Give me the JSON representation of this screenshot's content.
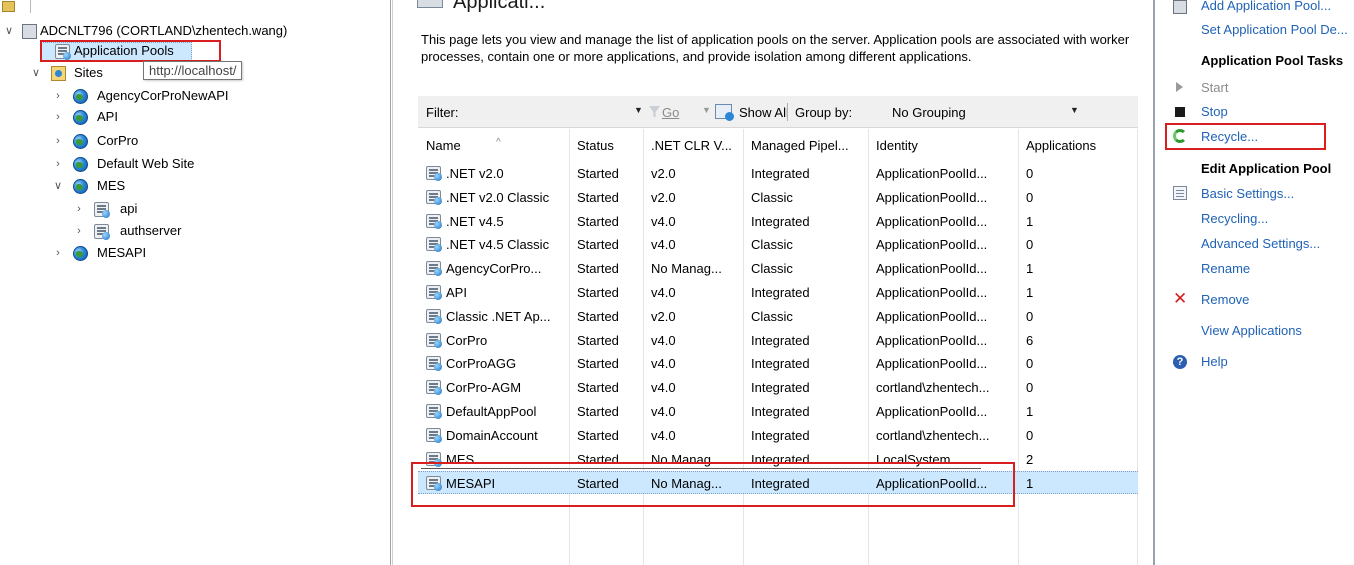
{
  "tree": {
    "server": "ADCNLT796 (CORTLAND\\zhentech.wang)",
    "application_pools": "Application Pools",
    "sites": "Sites",
    "tooltip": "http://localhost/",
    "site_items": [
      "AgencyCorProNewAPI",
      "API",
      "CorPro",
      "Default Web Site",
      "MES",
      "MESAPI"
    ],
    "mes_children": [
      "api",
      "authserver"
    ]
  },
  "main": {
    "title": "Applicati...",
    "description": "This page lets you view and manage the list of application pools on the server. Application pools are associated with worker processes, contain one or more applications, and provide isolation among different applications.",
    "filter_label": "Filter:",
    "filter_value": "",
    "go_label": "Go",
    "show_all_label": "Show All",
    "group_by_label": "Group by:",
    "group_by_value": "No Grouping",
    "columns": [
      "Name",
      "Status",
      ".NET CLR V...",
      "Managed Pipel...",
      "Identity",
      "Applications"
    ],
    "rows": [
      {
        "name": ".NET v2.0",
        "status": "Started",
        "clr": "v2.0",
        "pipeline": "Integrated",
        "identity": "ApplicationPoolId...",
        "apps": "0"
      },
      {
        "name": ".NET v2.0 Classic",
        "status": "Started",
        "clr": "v2.0",
        "pipeline": "Classic",
        "identity": "ApplicationPoolId...",
        "apps": "0"
      },
      {
        "name": ".NET v4.5",
        "status": "Started",
        "clr": "v4.0",
        "pipeline": "Integrated",
        "identity": "ApplicationPoolId...",
        "apps": "1"
      },
      {
        "name": ".NET v4.5 Classic",
        "status": "Started",
        "clr": "v4.0",
        "pipeline": "Classic",
        "identity": "ApplicationPoolId...",
        "apps": "0"
      },
      {
        "name": "AgencyCorPro...",
        "status": "Started",
        "clr": "No Manag...",
        "pipeline": "Classic",
        "identity": "ApplicationPoolId...",
        "apps": "1"
      },
      {
        "name": "API",
        "status": "Started",
        "clr": "v4.0",
        "pipeline": "Integrated",
        "identity": "ApplicationPoolId...",
        "apps": "1"
      },
      {
        "name": "Classic .NET Ap...",
        "status": "Started",
        "clr": "v2.0",
        "pipeline": "Classic",
        "identity": "ApplicationPoolId...",
        "apps": "0"
      },
      {
        "name": "CorPro",
        "status": "Started",
        "clr": "v4.0",
        "pipeline": "Integrated",
        "identity": "ApplicationPoolId...",
        "apps": "6"
      },
      {
        "name": "CorProAGG",
        "status": "Started",
        "clr": "v4.0",
        "pipeline": "Integrated",
        "identity": "ApplicationPoolId...",
        "apps": "0"
      },
      {
        "name": "CorPro-AGM",
        "status": "Started",
        "clr": "v4.0",
        "pipeline": "Integrated",
        "identity": "cortland\\zhentech...",
        "apps": "0"
      },
      {
        "name": "DefaultAppPool",
        "status": "Started",
        "clr": "v4.0",
        "pipeline": "Integrated",
        "identity": "ApplicationPoolId...",
        "apps": "1"
      },
      {
        "name": "DomainAccount",
        "status": "Started",
        "clr": "v4.0",
        "pipeline": "Integrated",
        "identity": "cortland\\zhentech...",
        "apps": "0"
      },
      {
        "name": "MES",
        "status": "Started",
        "clr": "No Manag...",
        "pipeline": "Integrated",
        "identity": "LocalSystem",
        "apps": "2"
      },
      {
        "name": "MESAPI",
        "status": "Started",
        "clr": "No Manag...",
        "pipeline": "Integrated",
        "identity": "ApplicationPoolId...",
        "apps": "1"
      }
    ]
  },
  "actions": {
    "add_pool": "Add Application Pool...",
    "set_defaults": "Set Application Pool De...",
    "tasks_header": "Application Pool Tasks",
    "start": "Start",
    "stop": "Stop",
    "recycle": "Recycle...",
    "edit_header": "Edit Application Pool",
    "basic_settings": "Basic Settings...",
    "recycling": "Recycling...",
    "advanced_settings": "Advanced Settings...",
    "rename": "Rename",
    "remove": "Remove",
    "view_applications": "View Applications",
    "help": "Help"
  },
  "colors": {
    "highlight": "#cce8ff",
    "annotation_red": "#d81e1e",
    "link_blue": "#1f62b6"
  }
}
